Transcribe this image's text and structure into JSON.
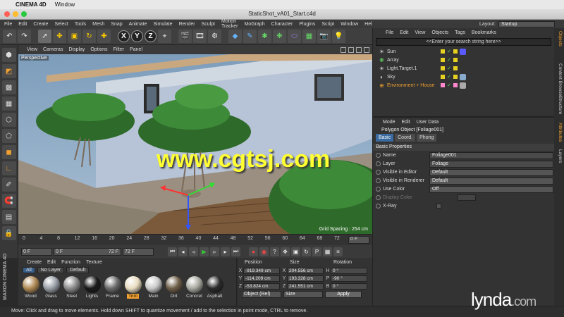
{
  "mac": {
    "app": "CINEMA 4D",
    "menu": [
      "Window"
    ]
  },
  "window": {
    "title": "StaticShot_vA01_Start.c4d"
  },
  "app_menu": [
    "File",
    "Edit",
    "Create",
    "Select",
    "Tools",
    "Mesh",
    "Snap",
    "Animate",
    "Simulate",
    "Render",
    "Sculpt",
    "Motion Tracker",
    "MoGraph",
    "Character",
    "Plugins",
    "Script",
    "Window",
    "Help"
  ],
  "layout": {
    "label": "Layout:",
    "value": "Startup"
  },
  "viewport": {
    "menu": [
      "View",
      "Cameras",
      "Display",
      "Options",
      "Filter",
      "Panel"
    ],
    "label": "Perspective",
    "grid_spacing": "Grid Spacing : 254 cm",
    "watermark": "www.cgtsj.com"
  },
  "timeline": {
    "ticks": [
      "0",
      "4",
      "8",
      "12",
      "16",
      "20",
      "24",
      "28",
      "32",
      "36",
      "40",
      "44",
      "48",
      "52",
      "56",
      "60",
      "64",
      "68",
      "72"
    ],
    "end_field": "0 F",
    "current": "0 F",
    "range_start": "0 F",
    "range_end": "72 F",
    "max": "72 F"
  },
  "materials": {
    "menu": [
      "Create",
      "Edit",
      "Function",
      "Texture"
    ],
    "filters": [
      "All",
      "No Layer",
      "Default"
    ],
    "items": [
      {
        "name": "Wood",
        "color": "#b08a55"
      },
      {
        "name": "Glass",
        "color": "#9aa0a8"
      },
      {
        "name": "Steel",
        "color": "#8c8c8c"
      },
      {
        "name": "Lights",
        "color": "#1a1a1a"
      },
      {
        "name": "Frame",
        "color": "#6a6a6a"
      },
      {
        "name": "Trim",
        "color": "#e8dcc0"
      },
      {
        "name": "Main",
        "color": "#c8c8c8"
      },
      {
        "name": "Dirt",
        "color": "#6e5e48"
      },
      {
        "name": "Concret",
        "color": "#a8a8a0"
      },
      {
        "name": "Asphalt",
        "color": "#2a2a2a"
      }
    ],
    "selected": "Trim",
    "brand": "MAXON CINEMA 4D"
  },
  "coords": {
    "headers": [
      "Position",
      "Size",
      "Rotation"
    ],
    "rows": [
      {
        "p_axis": "X",
        "p": "-919.349 cm",
        "s_axis": "X",
        "s": "204.556 cm",
        "r_axis": "H",
        "r": "0 °"
      },
      {
        "p_axis": "Y",
        "p": "-114.209 cm",
        "s_axis": "Y",
        "s": "193.328 cm",
        "r_axis": "P",
        "r": "-90 °"
      },
      {
        "p_axis": "Z",
        "p": "-53.824 cm",
        "s_axis": "Z",
        "s": "241.551 cm",
        "r_axis": "B",
        "r": "0 °"
      }
    ],
    "mode": "Object (Rel)",
    "size_mode": "Size",
    "apply": "Apply"
  },
  "objects": {
    "menu": [
      "File",
      "Edit",
      "View",
      "Objects",
      "Tags",
      "Bookmarks"
    ],
    "search": "<<Enter your search string here>>",
    "items": [
      {
        "name": "Sun",
        "icon": "light-icon",
        "color": "#dddddd"
      },
      {
        "name": "Array",
        "icon": "array-icon",
        "color": "#dddddd"
      },
      {
        "name": "Light.Target.1",
        "icon": "light-icon",
        "color": "#dddddd"
      },
      {
        "name": "Sky",
        "icon": "sky-icon",
        "color": "#dddddd"
      },
      {
        "name": "Environment + House",
        "icon": "null-icon",
        "color": "#f0a030"
      }
    ]
  },
  "attributes": {
    "menu": [
      "Mode",
      "Edit",
      "User Data"
    ],
    "object": "Polygon Object [Foliage001]",
    "tabs": [
      "Basic",
      "Coord.",
      "Phong"
    ],
    "section": "Basic Properties",
    "rows": [
      {
        "label": "Name",
        "value": "Foliage001",
        "kind": "input"
      },
      {
        "label": "Layer",
        "value": "Foliage",
        "kind": "input"
      },
      {
        "label": "Visible in Editor",
        "value": "Default",
        "kind": "select"
      },
      {
        "label": "Visible in Renderer",
        "value": "Default",
        "kind": "select"
      },
      {
        "label": "Use Color",
        "value": "Off",
        "kind": "select"
      },
      {
        "label": "Display Color",
        "value": "",
        "kind": "color"
      },
      {
        "label": "X-Ray",
        "value": "",
        "kind": "check"
      }
    ]
  },
  "right_tabs": [
    "Objects",
    "Content Browser",
    "Structure",
    "Attributes",
    "Layers"
  ],
  "status": "Move: Click and drag to move elements. Hold down SHIFT to quantize movement / add to the selection in point mode, CTRL to remove.",
  "brand": {
    "name": "lynda",
    "suffix": ".com"
  }
}
